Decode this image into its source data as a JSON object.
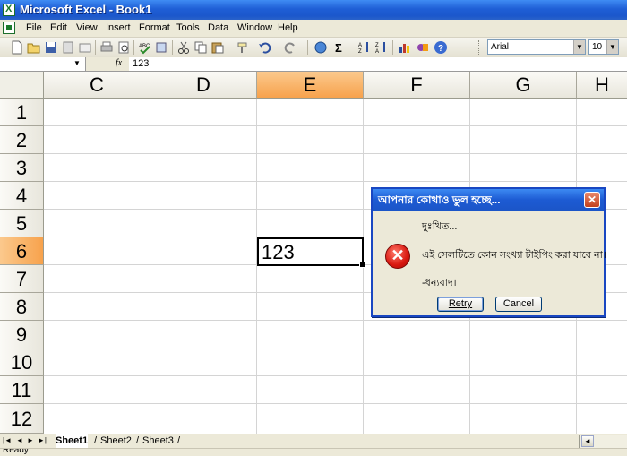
{
  "window": {
    "title": "Microsoft Excel - Book1"
  },
  "menu": [
    "File",
    "Edit",
    "View",
    "Insert",
    "Format",
    "Tools",
    "Data",
    "Window",
    "Help"
  ],
  "toolbar": {
    "icons": [
      "new-icon",
      "open-icon",
      "save-icon",
      "permission-icon",
      "email-icon",
      "print-icon",
      "print-preview-icon",
      "spelling-icon",
      "research-icon",
      "cut-icon",
      "copy-icon",
      "paste-icon",
      "format-painter-icon",
      "undo-icon",
      "redo-icon",
      "hyperlink-icon",
      "autosum-icon",
      "sort-ascending-icon",
      "sort-descending-icon",
      "chart-wizard-icon",
      "drawing-icon",
      "help-icon"
    ],
    "font_name": "Arial",
    "font_size": "10"
  },
  "formula_bar": {
    "name_box": "",
    "fx": "fx",
    "value": "123"
  },
  "grid": {
    "columns": [
      "C",
      "D",
      "E",
      "F",
      "G",
      "H"
    ],
    "rows": [
      "1",
      "2",
      "3",
      "4",
      "5",
      "6",
      "7",
      "8",
      "9",
      "10",
      "11",
      "12"
    ],
    "selected_column": "E",
    "selected_row": "6",
    "active_cell_value": "123"
  },
  "sheets": [
    "Sheet1",
    "Sheet2",
    "Sheet3"
  ],
  "active_sheet": "Sheet1",
  "status": "Ready",
  "dialog": {
    "title": "আপনার কোথাও ভুল হচ্ছে...",
    "line1": "দুঃখিত...",
    "message": "এই সেলটিতে কোন সংখ্যা টাইপিং করা যাবে না।",
    "line3": "-ধন্যবাদ।",
    "retry_label": "Retry",
    "cancel_label": "Cancel",
    "close_glyph": "✕",
    "icon": "error-icon"
  }
}
